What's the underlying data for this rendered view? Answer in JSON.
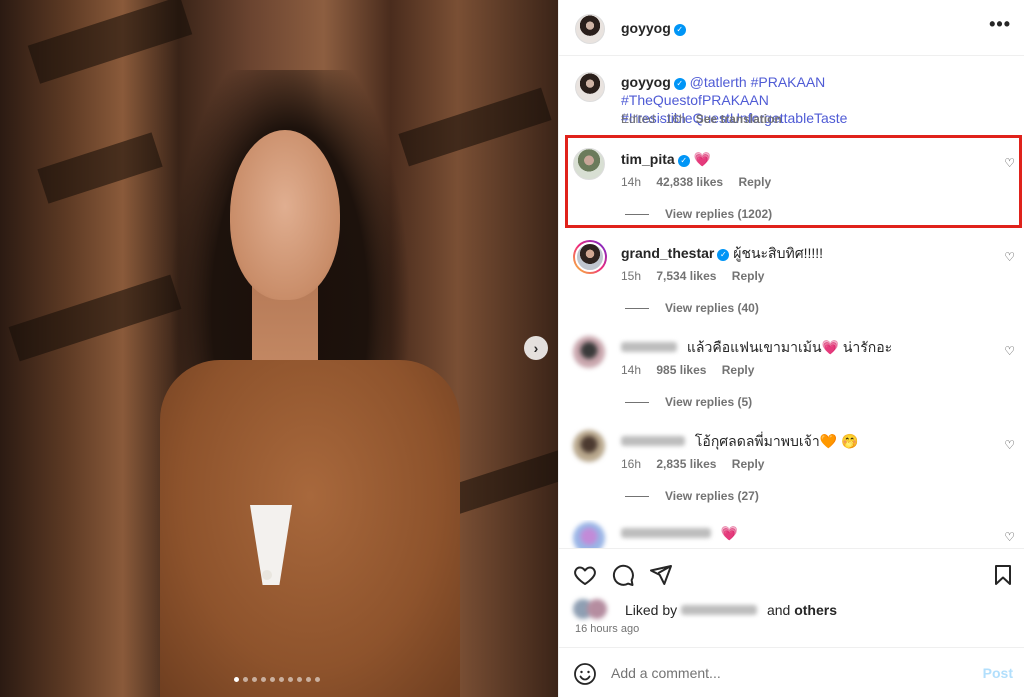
{
  "post": {
    "username": "goyyog",
    "caption_mention": "@tatlerth",
    "caption_tags_line1": "#PRAKAAN #TheQuestofPRAKAAN",
    "caption_tags_line2": "#IrresistibleQuestUnforgettableTaste",
    "caption_meta": "Edited · 16h",
    "see_translation": "See translation",
    "carousel_count": 10,
    "carousel_active_index": 0
  },
  "comments": [
    {
      "username": "tim_pita",
      "verified": true,
      "text": "",
      "emoji": "💗",
      "time": "14h",
      "likes": "42,838 likes",
      "reply": "Reply",
      "replies": "View replies (1202)"
    },
    {
      "username": "grand_thestar",
      "verified": true,
      "text": "ผู้ชนะสิบทิศ!!!!!",
      "time": "15h",
      "likes": "7,534 likes",
      "reply": "Reply",
      "replies": "View replies (40)"
    },
    {
      "username": "",
      "blurred": true,
      "text": "แล้วคือแฟนเขามาเม้น💗 น่ารักอะ",
      "time": "14h",
      "likes": "985 likes",
      "reply": "Reply",
      "replies": "View replies (5)"
    },
    {
      "username": "",
      "blurred": true,
      "text": "โอ้กุศลดลพี่มาพบเจ้า🧡 🤭",
      "time": "16h",
      "likes": "2,835 likes",
      "reply": "Reply",
      "replies": "View replies (27)"
    },
    {
      "username": "",
      "blurred": true,
      "text": "💗"
    }
  ],
  "actions": {
    "liked_by_prefix": "Liked by",
    "liked_by_and": "and",
    "liked_by_others": "others",
    "time_ago": "16 hours ago"
  },
  "composer": {
    "placeholder": "Add a comment...",
    "post_label": "Post"
  },
  "colors": {
    "verified": "#0095f6",
    "hashtag": "#4f5bd5",
    "highlight_box": "#e0221b",
    "post_disabled": "#b2dffc"
  },
  "icons": [
    "more-icon",
    "heart-icon",
    "comment-icon",
    "share-icon",
    "bookmark-icon",
    "emoji-icon",
    "verified-icon",
    "chevron-right-icon"
  ]
}
